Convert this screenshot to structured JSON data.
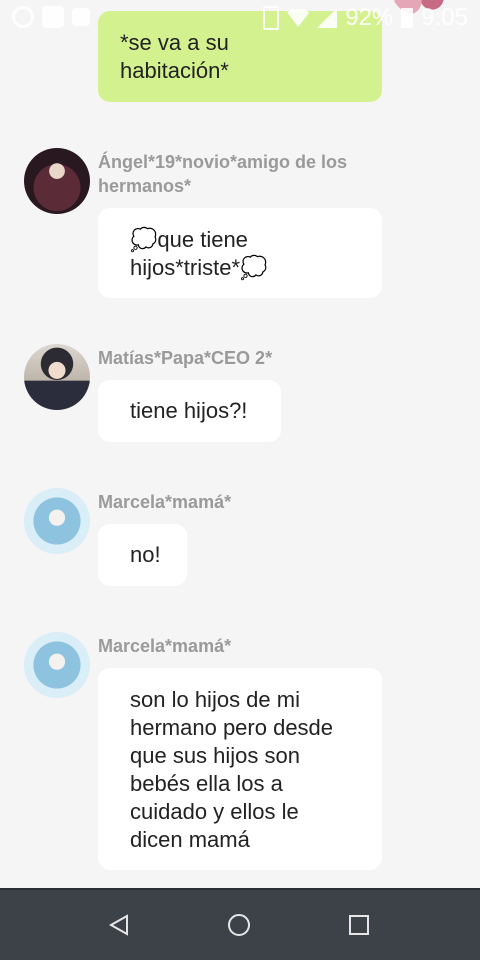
{
  "status_bar": {
    "battery": "92%",
    "time": "9:05",
    "icons": [
      "whatsapp-icon",
      "notification-icon",
      "image-icon",
      "vibrate-icon",
      "wifi-icon",
      "signal-icon",
      "battery-icon"
    ]
  },
  "messages": [
    {
      "sender": "",
      "own": true,
      "text": "*se va a su\nhabitación*"
    },
    {
      "sender": "Ángel*19*novio*amigo de los\nhermanos*",
      "own": false,
      "avatar": "avatar-angel",
      "text": "💭que tiene\nhijos*triste*💭"
    },
    {
      "sender": "Matías*Papa*CEO 2*",
      "own": false,
      "avatar": "avatar-matias",
      "text": "tiene hijos?!"
    },
    {
      "sender": "Marcela*mamá*",
      "own": false,
      "avatar": "avatar-marcela",
      "text": "no!"
    },
    {
      "sender": "Marcela*mamá*",
      "own": false,
      "avatar": "avatar-marcela",
      "text": "son lo hijos de mi\nhermano pero desde\nque sus hijos son\nbebés ella los a\ncuidado y ellos le\ndicen mamá"
    }
  ],
  "nav_bar": {
    "buttons": [
      "back-icon",
      "home-icon",
      "recents-icon"
    ]
  },
  "colors": {
    "background": "#f5f5f6",
    "own_bubble": "#d4f18f",
    "other_bubble": "#ffffff",
    "sender_name": "#9a9a9a",
    "nav_bar": "#3d4148"
  }
}
